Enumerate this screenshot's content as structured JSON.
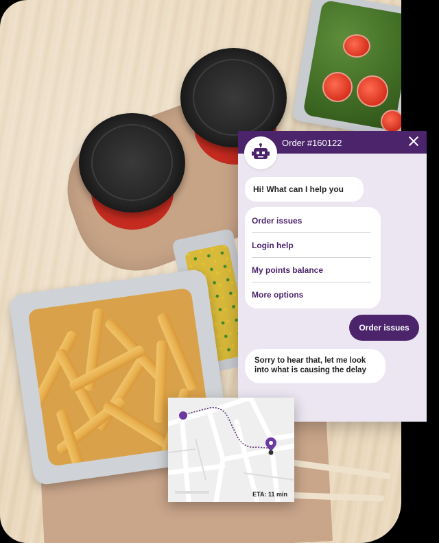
{
  "chat": {
    "title": "Order #160122",
    "close_icon": "close-icon",
    "avatar_icon": "robot-icon",
    "greeting": "Hi! What can I help you with?",
    "options": [
      {
        "label": "Order issues"
      },
      {
        "label": "Login help"
      },
      {
        "label": "My points balance"
      },
      {
        "label": "More options"
      }
    ],
    "user_message": "Order issues",
    "bot_reply": "Sorry to hear that, let me look into what is causing the delay"
  },
  "map": {
    "eta_text": "ETA: 11 min",
    "origin_icon": "origin-dot-icon",
    "destination_icon": "location-pin-icon"
  },
  "colors": {
    "brand_purple": "#4b246b",
    "chat_background": "#ebe6f1",
    "bubble_white": "#ffffff"
  }
}
